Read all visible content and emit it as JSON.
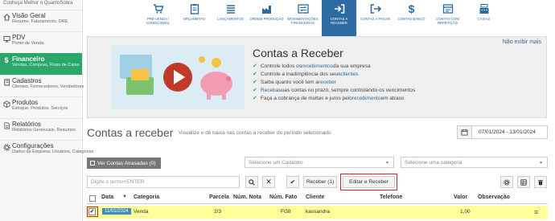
{
  "sidebar": {
    "top_text": "Conheça Melhor o QuantoSobra",
    "items": [
      {
        "icon": "home-icon",
        "title": "Visão Geral",
        "sub": "Resumo, Faturamento, DRE"
      },
      {
        "icon": "monitor-icon",
        "title": "PDV",
        "sub": "Ponto de Venda"
      },
      {
        "icon": "dollar-icon",
        "title": "Financeiro",
        "sub": "Vendas, Compras, Fluxo de Caixa"
      },
      {
        "icon": "book-icon",
        "title": "Cadastros",
        "sub": "Clientes, Fornecedores, Vendedores"
      },
      {
        "icon": "box-icon",
        "title": "Produtos",
        "sub": "Estoque, Produtos, Serviços"
      },
      {
        "icon": "doc-icon",
        "title": "Relatórios",
        "sub": "Relatórios Gerenciais, Resumos"
      },
      {
        "icon": "gear-icon",
        "title": "Configurações",
        "sub": "Dados da Empresa, Usuários, Categorias"
      }
    ]
  },
  "toolbar": {
    "items": [
      {
        "label": "Pré-venda / condicional",
        "icon": "cart-icon"
      },
      {
        "label": "Orçamento",
        "icon": "clipboard-icon"
      },
      {
        "label": "Lançamentos",
        "icon": "list-icon"
      },
      {
        "label": "Ordem produção",
        "icon": "factory-icon"
      },
      {
        "label": "Movimentações financeiras",
        "icon": "transfer-icon"
      },
      {
        "label": "Contas a receber",
        "icon": "login-icon"
      },
      {
        "label": "Contas a pagar",
        "icon": "logout-icon"
      },
      {
        "label": "Contas banco",
        "icon": "dollar-icon"
      },
      {
        "label": "Contas com repetição",
        "icon": "repeat-icon"
      },
      {
        "label": "Caixas",
        "icon": "register-icon"
      }
    ]
  },
  "banner": {
    "hide_link": "Não exibir mais",
    "title": "Contas a Receber",
    "bullets": [
      {
        "pre": "Controle todos os ",
        "hl": "recebimentos",
        "post": " da sua empresa"
      },
      {
        "pre": "Controle a inadimplência dos seus ",
        "hl": "clientes",
        "post": ""
      },
      {
        "pre": "Saiba quanto você tem a ",
        "hl": "receber",
        "post": ""
      },
      {
        "pre": "",
        "hl": "Receba",
        "post": " suas contas no prazo, sempre controlando os vencimentos"
      },
      {
        "pre": "Faça a cobrança de multas e juros pelo ",
        "hl": "recebimento",
        "post": " em atraso"
      }
    ]
  },
  "header": {
    "title": "Contas a receber",
    "subtitle": "Visualize e dê baixa nas contas a receber do período selecionado",
    "date_range": "07/01/2024 - 13/01/2024"
  },
  "filters": {
    "overdue_button": "Ver Contas Atrasadas (0)",
    "cadastro_placeholder": "Selecione um Cadastro",
    "category_placeholder": "Selecione uma categoria",
    "search_placeholder": "Digite o termo+ENTER"
  },
  "actions": {
    "receive_button": "Receber (1)",
    "edit_receive_button": "Editar e Receber"
  },
  "table": {
    "headers": [
      "Data",
      "Categoria",
      "Parcela",
      "Núm. Nota",
      "Núm. Fato",
      "Cliente",
      "Telefone",
      "Valor",
      "Observação"
    ],
    "rows": [
      {
        "date": "11/01/2024",
        "category": "Venda",
        "parcela": "2/3",
        "nota": "",
        "fato": "FG8",
        "cliente": "kassandra",
        "telefone": "",
        "valor": "1,00",
        "obs": ""
      }
    ]
  },
  "colors": {
    "brand_green": "#2aa86a",
    "brand_blue": "#2d6ca2",
    "highlight_red": "#d0212a",
    "row_yellow": "#ffff99"
  }
}
